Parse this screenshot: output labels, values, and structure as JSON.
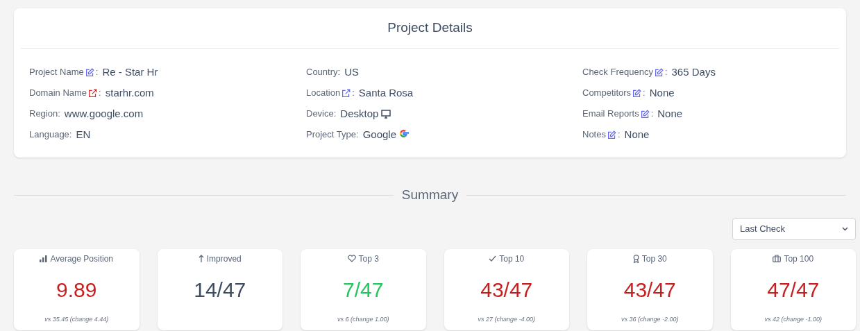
{
  "project_details": {
    "title": "Project Details",
    "columns": [
      [
        {
          "kind": "edit",
          "label": "Project Name",
          "separator": ":",
          "value": "Re - Star Hr"
        },
        {
          "kind": "link",
          "label": "Domain Name",
          "separator": ":",
          "value": "starhr.com"
        },
        {
          "kind": "plain",
          "label": "Region:",
          "value": "www.google.com"
        },
        {
          "kind": "plain",
          "label": "Language:",
          "value": "EN"
        }
      ],
      [
        {
          "kind": "plain",
          "label": "Country:",
          "value": "US"
        },
        {
          "kind": "link_edit",
          "label": "Location",
          "separator": ":",
          "value": "Santa Rosa"
        },
        {
          "kind": "desktop",
          "label": "Device:",
          "value": "Desktop"
        },
        {
          "kind": "google",
          "label": "Project Type:",
          "value": "Google"
        }
      ],
      [
        {
          "kind": "edit",
          "label": "Check Frequency",
          "separator": ":",
          "value": "365 Days"
        },
        {
          "kind": "edit",
          "label": "Competitors",
          "separator": ":",
          "value": "None"
        },
        {
          "kind": "edit",
          "label": "Email Reports",
          "separator": ":",
          "value": "None"
        },
        {
          "kind": "edit",
          "label": "Notes",
          "separator": ":",
          "value": "None"
        }
      ]
    ]
  },
  "summary": {
    "title": "Summary",
    "period": {
      "value": "Last Check"
    },
    "cards": [
      {
        "kind": "average",
        "label": "Average Position",
        "value": "9.89",
        "color": "#c81e1e",
        "comparison": "vs 35.45 (change 4.44)"
      },
      {
        "kind": "improved",
        "label": "Improved",
        "value": "14/47",
        "color": "#3f4d63"
      },
      {
        "kind": "top3",
        "label": "Top 3",
        "value": "7/47",
        "color": "#22c55e",
        "comparison": "vs 6 (change 1.00)"
      },
      {
        "kind": "top10",
        "label": "Top 10",
        "value": "43/47",
        "color": "#c81e1e",
        "comparison": "vs 27 (change -4.00)"
      },
      {
        "kind": "top30",
        "label": "Top 30",
        "value": "43/47",
        "color": "#c81e1e",
        "comparison": "vs 36 (change -2.00)"
      },
      {
        "kind": "top100",
        "label": "Top 100",
        "value": "47/47",
        "color": "#c81e1e",
        "comparison": "vs 42 (change -1.00)"
      }
    ]
  }
}
